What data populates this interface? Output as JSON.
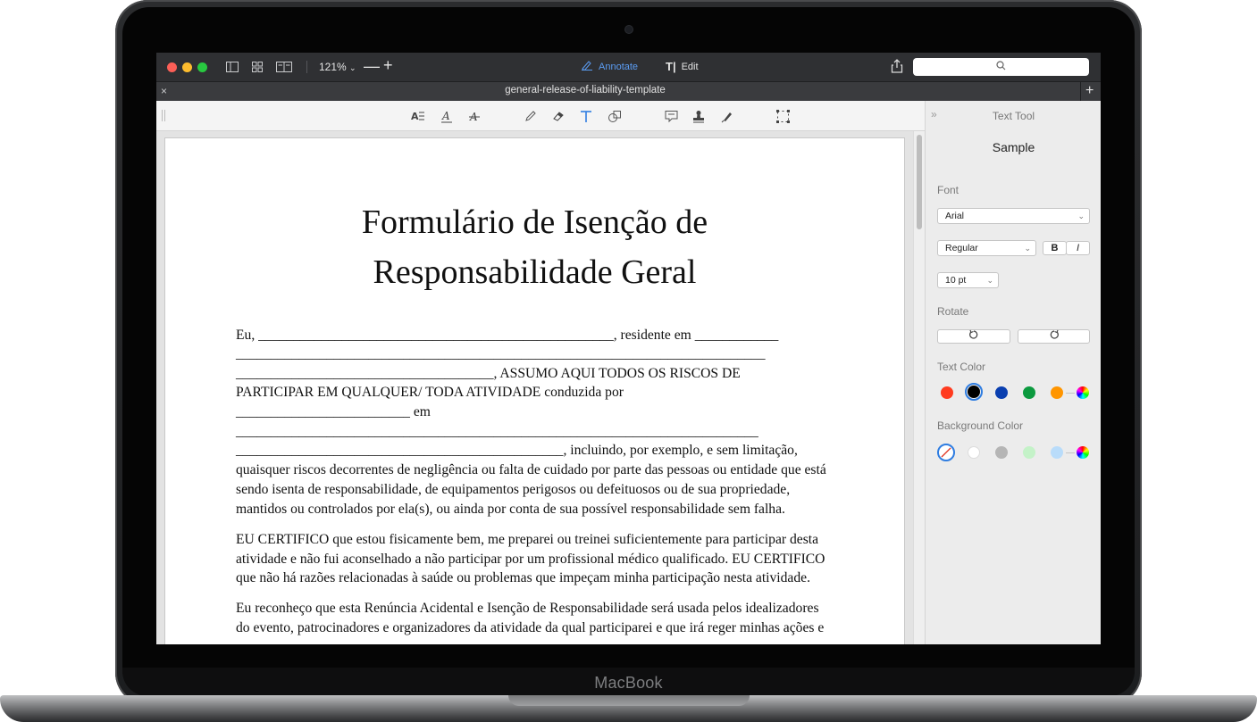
{
  "device": {
    "brand": "MacBook"
  },
  "toolbar": {
    "zoom": "121%",
    "zoom_minus": "—",
    "zoom_plus": "+",
    "annotate_label": "Annotate",
    "edit_label": "Edit",
    "search_placeholder": ""
  },
  "tab": {
    "close": "×",
    "title": "general-release-of-liability-template",
    "add": "+"
  },
  "panel": {
    "collapse": "»",
    "title": "Text Tool",
    "sample": "Sample",
    "font_label": "Font",
    "font_family": "Arial",
    "font_style": "Regular",
    "bold": "B",
    "italic": "I",
    "font_size": "10 pt",
    "rotate_label": "Rotate",
    "text_color_label": "Text Color",
    "text_colors": [
      "#ff3b1f",
      "#000000",
      "#0a3fb0",
      "#0c9a3f",
      "#ff9500"
    ],
    "background_color_label": "Background Color",
    "background_colors": [
      "#ffffff",
      "#b5b5b5",
      "#c4f2c8",
      "#b9dcfa"
    ]
  },
  "document": {
    "title_line1": "Formulário de Isenção de",
    "title_line2": "Responsabilidade Geral",
    "lines": [
      "Eu, ___________________________________________________, residente em ____________",
      "____________________________________________________________________________",
      "_____________________________________, ASSUMO AQUI TODOS OS RISCOS DE",
      "PARTICIPAR EM QUALQUER/ TODA ATIVIDADE conduzida por",
      "_________________________ em",
      "___________________________________________________________________________",
      "_______________________________________________, incluindo, por exemplo, e sem limitação,",
      "quaisquer riscos decorrentes de negligência ou falta de cuidado por parte das pessoas ou entidade que está",
      "sendo isenta de responsabilidade, de equipamentos perigosos ou defeituosos ou de sua propriedade,",
      "mantidos ou controlados por ela(s), ou ainda por conta de sua possível responsabilidade sem falha.",
      "EU CERTIFICO que estou fisicamente bem, me preparei ou treinei suficientemente para participar desta",
      "atividade e não fui aconselhado a não participar por um profissional médico qualificado. EU CERTIFICO",
      "que não há razões relacionadas à saúde ou problemas que impeçam minha participação nesta atividade.",
      "Eu reconheço que esta Renúncia Acidental e Isenção de Responsabilidade será usada pelos idealizadores",
      "do evento, patrocinadores e organizadores da atividade da qual participarei e que irá reger minhas ações e"
    ]
  }
}
